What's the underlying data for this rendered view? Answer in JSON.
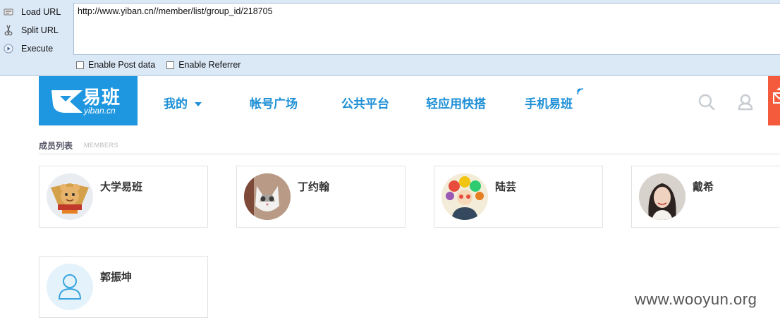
{
  "hackbar": {
    "menu": [
      {
        "label": "Load URL",
        "icon": "load-url-icon"
      },
      {
        "label": "Split URL",
        "icon": "scissors-icon"
      },
      {
        "label": "Execute",
        "icon": "play-icon"
      }
    ],
    "url": "http://www.yiban.cn//member/list/group_id/218705",
    "options": [
      {
        "label": "Enable Post data",
        "checked": false
      },
      {
        "label": "Enable Referrer",
        "checked": false
      }
    ]
  },
  "site": {
    "logo_text": "易班",
    "logo_sub": "yiban.cn",
    "nav": [
      "我的",
      "帐号广场",
      "公共平台",
      "轻应用快搭",
      "手机易班"
    ],
    "accent": "#1e97e0"
  },
  "section": {
    "title": "成员列表",
    "subtitle": "MEMBERS"
  },
  "members": [
    {
      "name": "大学易班"
    },
    {
      "name": "丁约翰"
    },
    {
      "name": "陆芸"
    },
    {
      "name": "戴希"
    },
    {
      "name": "郭振坤"
    }
  ],
  "watermark": "www.wooyun.org"
}
